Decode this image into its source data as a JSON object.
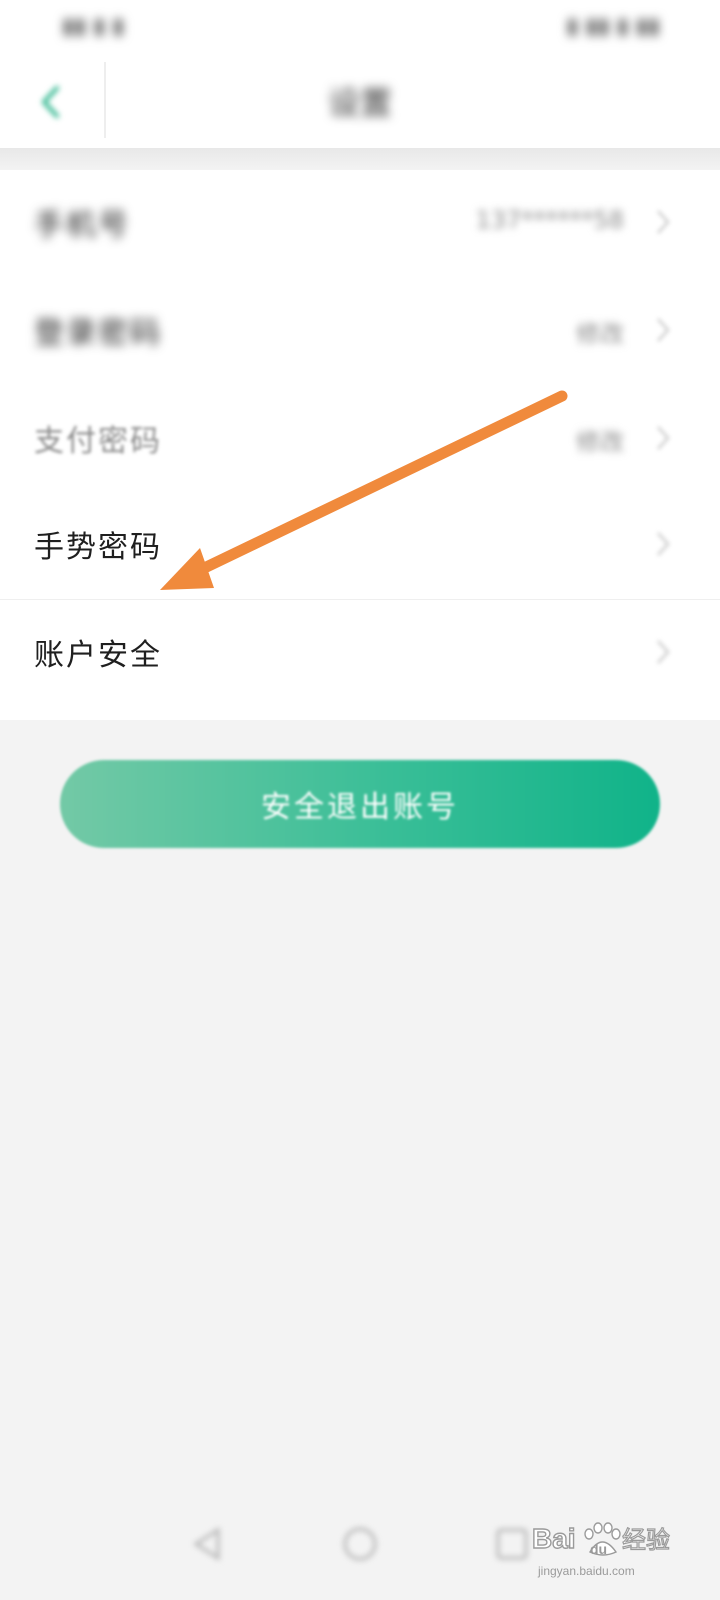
{
  "status_bar": {
    "left_text": "▮▮ ▮ ▮",
    "right_text": "▮ ▮▮ ▮ ▮▮"
  },
  "header": {
    "title": "设置",
    "back_icon": "chevron-left-icon"
  },
  "settings": {
    "items": [
      {
        "label": "手机号",
        "value": "137******58"
      },
      {
        "label": "登录密码",
        "value": "修改"
      },
      {
        "label": "支付密码",
        "value": "修改"
      },
      {
        "label": "手势密码",
        "value": ""
      },
      {
        "label": "账户安全",
        "value": ""
      }
    ]
  },
  "logout": {
    "label": "安全退出账号"
  },
  "nav": {
    "back_icon": "nav-back-icon",
    "home_icon": "nav-home-icon",
    "recent_icon": "nav-recent-icon"
  },
  "watermark": {
    "brand": "Bai",
    "brand_suffix": "du",
    "jingyan": "经验",
    "url": "jingyan.baidu.com"
  },
  "colors": {
    "accent_start": "#73c9a6",
    "accent_end": "#10b389",
    "annotation_arrow": "#f08a3c",
    "background": "#f3f3f3"
  }
}
